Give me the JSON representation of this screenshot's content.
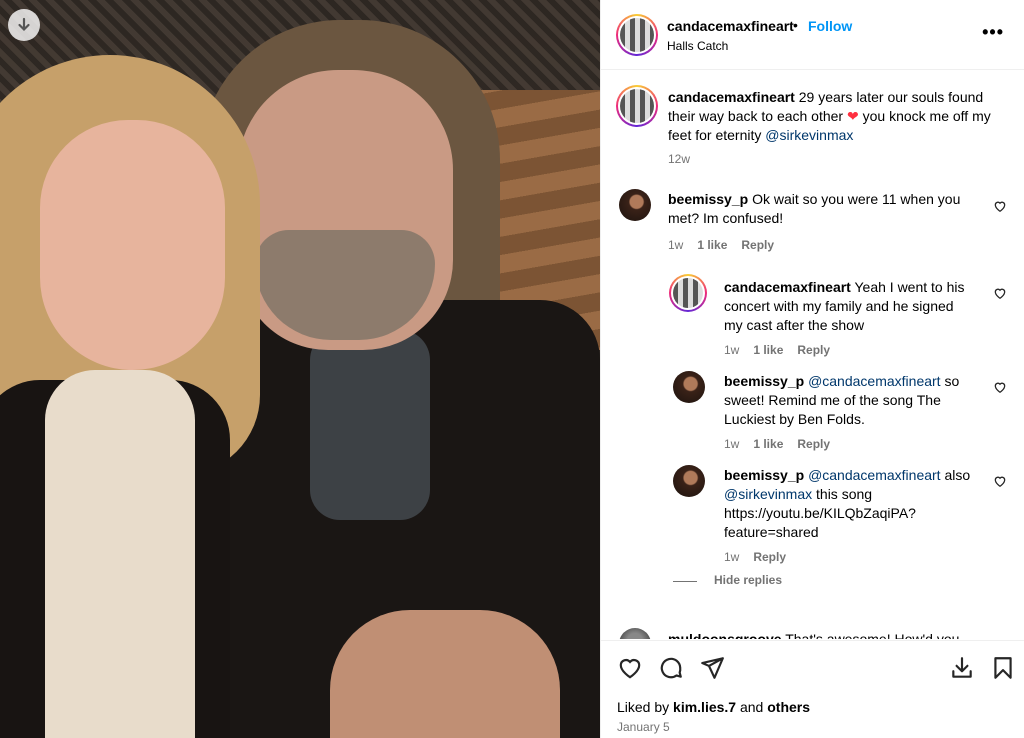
{
  "header": {
    "username": "candacemaxfineart",
    "separator": "•",
    "follow_label": "Follow",
    "location": "Halls Catch",
    "more_label": "•••"
  },
  "caption": {
    "username": "candacemaxfineart",
    "text_before": "29 years later our souls found their way back to each other",
    "text_after": "you knock me off my feet for eternity",
    "mention": "@sirkevinmax",
    "heart": "❤",
    "time": "12w"
  },
  "comments": [
    {
      "username": "beemissy_p",
      "text": "Ok wait so you were 11 when you met? Im confused!",
      "time": "1w",
      "likes": "1 like",
      "reply": "Reply"
    },
    {
      "username": "candacemaxfineart",
      "text": "Yeah I went to his concert with my family and he signed my cast after the show",
      "time": "1w",
      "likes": "1 like",
      "reply": "Reply"
    },
    {
      "username": "beemissy_p",
      "mention": "@candacemaxfineart",
      "text": "so sweet! Remind me of the song The Luckiest by Ben Folds.",
      "time": "1w",
      "likes": "1 like",
      "reply": "Reply"
    },
    {
      "username": "beemissy_p",
      "mention": "@candacemaxfineart",
      "text_mid": "also",
      "mention2": "@sirkevinmax",
      "text": "this song https://youtu.be/KILQbZaqiPA?feature=shared",
      "time": "1w",
      "reply": "Reply"
    },
    {
      "username": "muldoonsgroove",
      "text": "That's awesome! How'd you"
    }
  ],
  "hide_replies": "Hide replies",
  "footer": {
    "liked_by_prefix": "Liked by",
    "liked_by_user": "kim.lies.7",
    "and": "and",
    "others": "others",
    "date": "January 5"
  }
}
